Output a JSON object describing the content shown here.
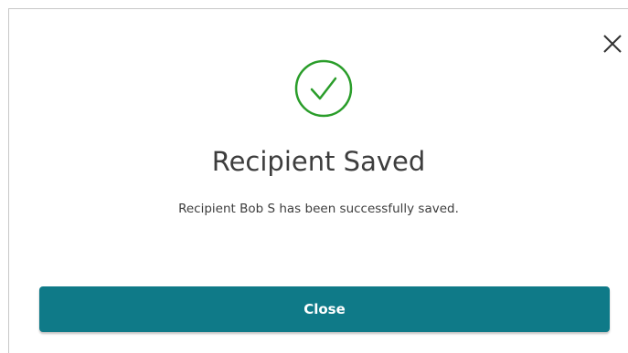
{
  "dialog": {
    "title": "Recipient Saved",
    "message": "Recipient Bob S has been successfully saved.",
    "close_button_label": "Close",
    "icons": {
      "dismiss": "close-icon",
      "status": "success-checkmark-icon"
    },
    "colors": {
      "accent": "#0f7a88",
      "success": "#2a9d2a",
      "text": "#3d3d3d"
    }
  }
}
